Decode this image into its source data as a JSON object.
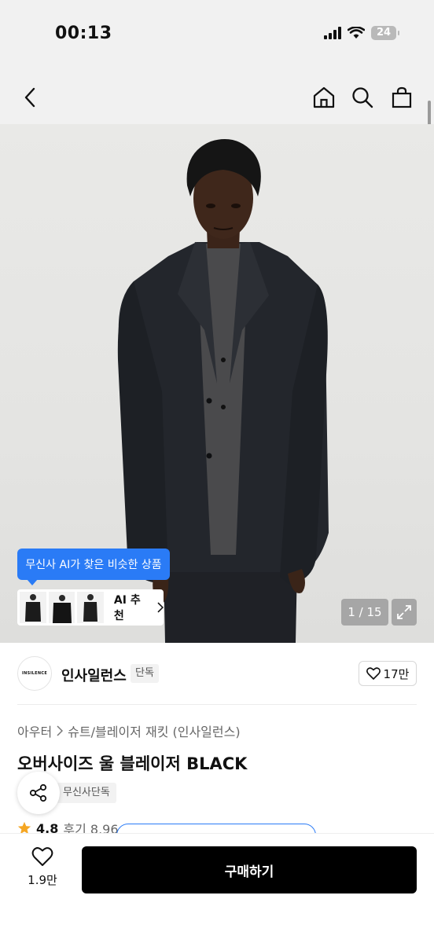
{
  "status_bar": {
    "time": "00:13",
    "battery": "24"
  },
  "nav": {
    "icons": [
      "back-icon",
      "home-icon",
      "search-icon",
      "bag-icon"
    ]
  },
  "gallery": {
    "ai_tooltip": "무신사 AI가 찾은 비슷한 상품",
    "ai_recommend_label": "AI 추천",
    "page_counter": "1 / 15"
  },
  "brand": {
    "logo_text": "INSILENCE",
    "name": "인사일런스",
    "tag": "단독",
    "like_count": "17만"
  },
  "breadcrumb": {
    "category": "아우터",
    "subcategory": "슈트/블레이저 재킷 (인사일런스)"
  },
  "product": {
    "title": "오버사이즈 울 블레이저 BLACK",
    "exclusive_badge": "무신사단독",
    "rating": "4.8",
    "reviews": "후기 8,96"
  },
  "bottom_bar": {
    "wish_count": "1.9만",
    "buy_label": "구매하기"
  },
  "colors": {
    "accent": "#2a7bf6",
    "buy_button": "#000000",
    "star": "#f5a623"
  }
}
